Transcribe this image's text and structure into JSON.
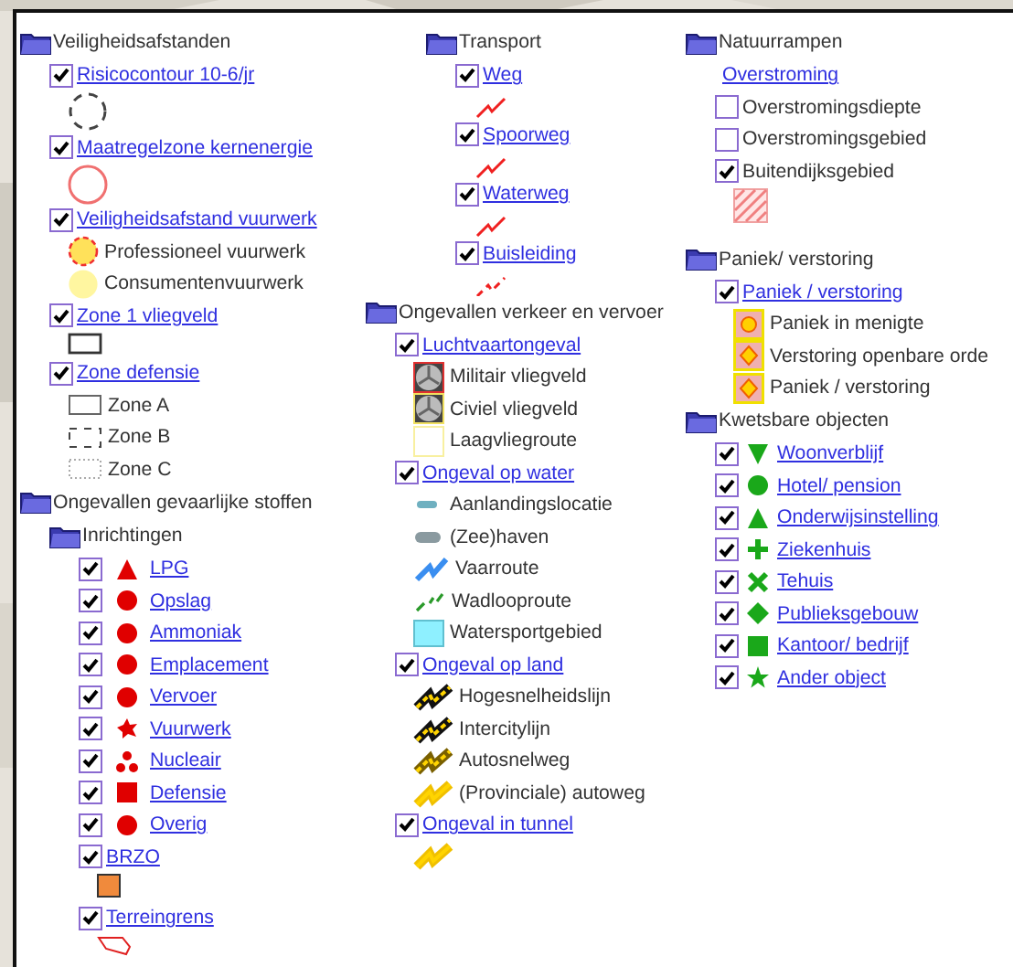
{
  "columns": [
    {
      "nodes": [
        {
          "kind": "folder",
          "label": "Veiligheidsafstanden",
          "children": [
            {
              "kind": "layer",
              "label": "Risicocontour 10-6/jr",
              "checked": true,
              "legend": [
                {
                  "kind": "dashed-circle"
                }
              ]
            },
            {
              "kind": "layer",
              "label": "Maatregelzone kernenergie",
              "checked": true,
              "legend": [
                {
                  "kind": "ring"
                }
              ]
            },
            {
              "kind": "layer",
              "label": "Veiligheidsafstand vuurwerk",
              "checked": true,
              "legend": [
                {
                  "kind": "dashed-disc",
                  "label": "Professioneel vuurwerk"
                },
                {
                  "kind": "disc",
                  "label": "Consumentenvuurwerk"
                }
              ]
            },
            {
              "kind": "layer",
              "label": "Zone 1 vliegveld",
              "checked": true,
              "legend": [
                {
                  "kind": "rect"
                }
              ]
            },
            {
              "kind": "layer",
              "label": "Zone defensie",
              "checked": true,
              "legend": [
                {
                  "kind": "rect-thin",
                  "label": "Zone A"
                },
                {
                  "kind": "rect-dashed",
                  "label": "Zone B"
                },
                {
                  "kind": "rect-dotted",
                  "label": "Zone C"
                }
              ]
            }
          ]
        },
        {
          "kind": "folder",
          "label": "Ongevallen gevaarlijke stoffen",
          "children": [
            {
              "kind": "folder",
              "label": "Inrichtingen",
              "children": [
                {
                  "kind": "layer",
                  "label": "LPG",
                  "checked": true,
                  "marker": {
                    "kind": "triangle",
                    "color": "#e00000"
                  }
                },
                {
                  "kind": "layer",
                  "label": "Opslag",
                  "checked": true,
                  "marker": {
                    "kind": "circle",
                    "color": "#e00000"
                  }
                },
                {
                  "kind": "layer",
                  "label": "Ammoniak",
                  "checked": true,
                  "marker": {
                    "kind": "circle",
                    "color": "#e00000"
                  }
                },
                {
                  "kind": "layer",
                  "label": "Emplacement",
                  "checked": true,
                  "marker": {
                    "kind": "circle",
                    "color": "#e00000"
                  }
                },
                {
                  "kind": "layer",
                  "label": "Vervoer",
                  "checked": true,
                  "marker": {
                    "kind": "circle",
                    "color": "#e00000"
                  }
                },
                {
                  "kind": "layer",
                  "label": "Vuurwerk",
                  "checked": true,
                  "marker": {
                    "kind": "burst",
                    "color": "#e00000"
                  }
                },
                {
                  "kind": "layer",
                  "label": "Nucleair",
                  "checked": true,
                  "marker": {
                    "kind": "trefoil",
                    "color": "#e00000"
                  }
                },
                {
                  "kind": "layer",
                  "label": "Defensie",
                  "checked": true,
                  "marker": {
                    "kind": "square",
                    "color": "#e00000"
                  }
                },
                {
                  "kind": "layer",
                  "label": "Overig",
                  "checked": true,
                  "marker": {
                    "kind": "circle",
                    "color": "#e00000"
                  }
                },
                {
                  "kind": "layer",
                  "label": "BRZO",
                  "checked": true,
                  "legend": [
                    {
                      "kind": "orange-square"
                    }
                  ]
                },
                {
                  "kind": "layer",
                  "label": "Terreingrens",
                  "checked": true,
                  "legend": [
                    {
                      "kind": "outline-shape"
                    }
                  ]
                }
              ]
            }
          ]
        }
      ]
    },
    {
      "nodes": [
        {
          "kind": "continuation",
          "children": [
            {
              "kind": "folder",
              "label": "Transport",
              "children": [
                {
                  "kind": "layer",
                  "label": "Weg",
                  "checked": true,
                  "legend": [
                    {
                      "kind": "zigzag"
                    }
                  ]
                },
                {
                  "kind": "layer",
                  "label": "Spoorweg",
                  "checked": true,
                  "legend": [
                    {
                      "kind": "zigzag"
                    }
                  ]
                },
                {
                  "kind": "layer",
                  "label": "Waterweg",
                  "checked": true,
                  "legend": [
                    {
                      "kind": "zigzag"
                    }
                  ]
                },
                {
                  "kind": "layer",
                  "label": "Buisleiding",
                  "checked": true,
                  "legend": [
                    {
                      "kind": "dashed-zigzag"
                    }
                  ]
                }
              ]
            }
          ]
        },
        {
          "kind": "folder",
          "label": "Ongevallen verkeer en vervoer",
          "children": [
            {
              "kind": "layer",
              "label": "Luchtvaartongeval",
              "checked": true,
              "legend": [
                {
                  "kind": "airfield-military",
                  "label": "Militair vliegveld"
                },
                {
                  "kind": "airfield-civil",
                  "label": "Civiel vliegveld"
                },
                {
                  "kind": "outline-square",
                  "label": "Laagvliegroute"
                }
              ]
            },
            {
              "kind": "layer",
              "label": "Ongeval op water",
              "checked": true,
              "legend": [
                {
                  "kind": "short-dash",
                  "label": "Aanlandingslocatie"
                },
                {
                  "kind": "thick-dash",
                  "label": "(Zee)haven"
                },
                {
                  "kind": "blue-zigzag",
                  "label": "Vaarroute"
                },
                {
                  "kind": "dashes",
                  "label": "Wadlooproute"
                },
                {
                  "kind": "water-square",
                  "label": "Watersportgebied"
                }
              ]
            },
            {
              "kind": "layer",
              "label": "Ongeval op land",
              "checked": true,
              "legend": [
                {
                  "kind": "rail-fast",
                  "label": "Hogesnelheidslijn"
                },
                {
                  "kind": "rail",
                  "label": "Intercitylijn"
                },
                {
                  "kind": "road-double",
                  "label": "Autosnelweg"
                },
                {
                  "kind": "road",
                  "label": "(Provinciale) autoweg"
                }
              ]
            },
            {
              "kind": "layer",
              "label": "Ongeval in tunnel",
              "checked": true,
              "legend": [
                {
                  "kind": "road"
                }
              ]
            }
          ]
        }
      ]
    },
    {
      "nodes": [
        {
          "kind": "folder",
          "label": "Natuurrampen",
          "children": [
            {
              "kind": "link",
              "label": "Overstroming"
            },
            {
              "kind": "option",
              "label": "Overstromingsdiepte",
              "checked": false
            },
            {
              "kind": "option",
              "label": "Overstromingsgebied",
              "checked": false
            },
            {
              "kind": "option",
              "label": "Buitendijksgebied",
              "checked": true,
              "legend": [
                {
                  "kind": "hatched-square"
                }
              ]
            }
          ]
        },
        {
          "kind": "folder",
          "label": "Paniek/ verstoring",
          "children": [
            {
              "kind": "layer",
              "label": "Paniek / verstoring",
              "checked": true,
              "legend": [
                {
                  "kind": "badge-dot",
                  "label": "Paniek in menigte"
                },
                {
                  "kind": "badge-diamond",
                  "label": "Verstoring openbare orde"
                },
                {
                  "kind": "badge-diamond",
                  "label": "Paniek / verstoring"
                }
              ]
            }
          ]
        },
        {
          "kind": "folder",
          "label": "Kwetsbare objecten",
          "children": [
            {
              "kind": "layer",
              "label": "Woonverblijf",
              "checked": true,
              "marker": {
                "kind": "triangle-down",
                "color": "#1aa81a"
              }
            },
            {
              "kind": "layer",
              "label": "Hotel/ pension",
              "checked": true,
              "marker": {
                "kind": "circle",
                "color": "#1aa81a"
              }
            },
            {
              "kind": "layer",
              "label": "Onderwijsinstelling",
              "checked": true,
              "marker": {
                "kind": "triangle",
                "color": "#1aa81a"
              }
            },
            {
              "kind": "layer",
              "label": "Ziekenhuis",
              "checked": true,
              "marker": {
                "kind": "plus",
                "color": "#1aa81a"
              }
            },
            {
              "kind": "layer",
              "label": "Tehuis",
              "checked": true,
              "marker": {
                "kind": "cross",
                "color": "#1aa81a"
              }
            },
            {
              "kind": "layer",
              "label": "Publieksgebouw",
              "checked": true,
              "marker": {
                "kind": "diamond",
                "color": "#1aa81a"
              }
            },
            {
              "kind": "layer",
              "label": "Kantoor/ bedrijf",
              "checked": true,
              "marker": {
                "kind": "square",
                "color": "#1aa81a"
              }
            },
            {
              "kind": "layer",
              "label": "Ander object",
              "checked": true,
              "marker": {
                "kind": "star",
                "color": "#1aa81a"
              }
            }
          ]
        }
      ]
    }
  ]
}
